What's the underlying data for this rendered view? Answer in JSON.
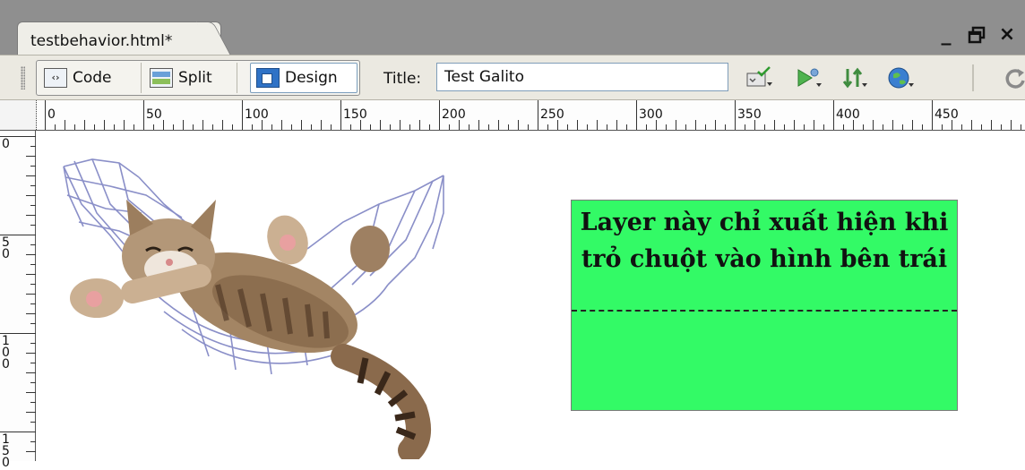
{
  "document_tab": {
    "label": "testbehavior.html*"
  },
  "window_controls": {
    "minimize": "_",
    "restore": "🗗",
    "close": "×"
  },
  "toolbar": {
    "code_label": "Code",
    "split_label": "Split",
    "design_label": "Design",
    "active_view": "Design",
    "title_label": "Title:",
    "title_value": "Test Galito",
    "icons": [
      "validate-markup-icon",
      "preview-debug-icon",
      "file-management-icon",
      "browser-check-icon",
      "refresh-icon"
    ]
  },
  "ruler": {
    "horizontal_labels": [
      "0",
      "50",
      "100",
      "150",
      "200",
      "250",
      "300",
      "350",
      "400",
      "450",
      "50"
    ],
    "vertical_labels": [
      "0",
      "50",
      "100",
      "150"
    ]
  },
  "canvas": {
    "image": "cat-in-hammock-image",
    "layer": {
      "text": "Layer này chỉ xuất hiện khi trỏ chuột vào hình bên trái",
      "background": "#33fa66"
    }
  },
  "colors": {
    "tabstrip": "#8f8f8f",
    "toolbar": "#ebe9e1",
    "layer_green": "#33fa66"
  }
}
